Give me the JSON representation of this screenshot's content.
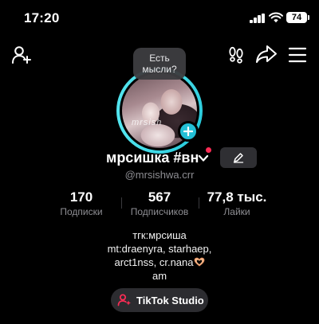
{
  "status_bar": {
    "time": "17:20",
    "battery": "74"
  },
  "avatar": {
    "watermark": "mrsish",
    "bubble_line1": "Есть",
    "bubble_line2": "мысли?"
  },
  "profile": {
    "display_name": "мрсишка #вн",
    "username": "@mrsishwa.crr"
  },
  "stats": [
    {
      "value": "170",
      "label": "Подписки"
    },
    {
      "value": "567",
      "label": "Подписчиков"
    },
    {
      "value": "77,8 тыс.",
      "label": "Лайки"
    }
  ],
  "bio": {
    "line1": "тгк:мрсиша",
    "line2": "mt:draenyra, starhaep,",
    "line3": "arct1nss, cr.nana",
    "line4": "am"
  },
  "studio_button": {
    "label": "TikTok Studio"
  },
  "colors": {
    "background": "#000000",
    "ring": "#23c6d8",
    "plus": "#23bfd6",
    "notification_dot": "#fe2c55",
    "secondary_text": "#8e8e93"
  }
}
